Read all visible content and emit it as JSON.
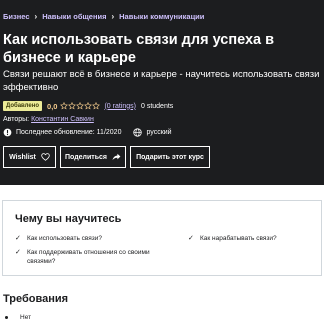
{
  "breadcrumb": {
    "items": [
      "Бизнес",
      "Навыки общения",
      "Навыки коммуникации"
    ],
    "separator": "›"
  },
  "course": {
    "title": "Как использовать связи для успеха в бизнесе и карьере",
    "subtitle": "Связи решают всё в бизнесе и карьере - научитесь использовать связи эффективно",
    "badge": "Добавлено",
    "rating": "0,0",
    "ratings_count": "(0 ratings)",
    "students": "0 students",
    "authors_label": "Авторы:",
    "author": "Константин Савкин",
    "last_updated": "Последнее обновление: 11/2020",
    "language": "русский"
  },
  "buttons": {
    "wishlist": "Wishlist",
    "share": "Поделиться",
    "gift": "Подарить этот курс"
  },
  "learn": {
    "title": "Чему вы научитесь",
    "items": [
      "Как использовать связи?",
      "Как нарабатывать связи?",
      "Как поддерживать отношения со своими связями?"
    ]
  },
  "requirements": {
    "title": "Требования",
    "items": [
      "Нет"
    ]
  },
  "colors": {
    "hero_bg": "#1c1d1f",
    "link": "#cec0fc",
    "badge_bg": "#eceb98",
    "rating": "#f3ca8c"
  },
  "icons": [
    "chevron-right-icon",
    "star-outline-icon",
    "alert-icon",
    "globe-icon",
    "heart-icon",
    "share-arrow-icon",
    "check-icon",
    "bullet-icon"
  ]
}
